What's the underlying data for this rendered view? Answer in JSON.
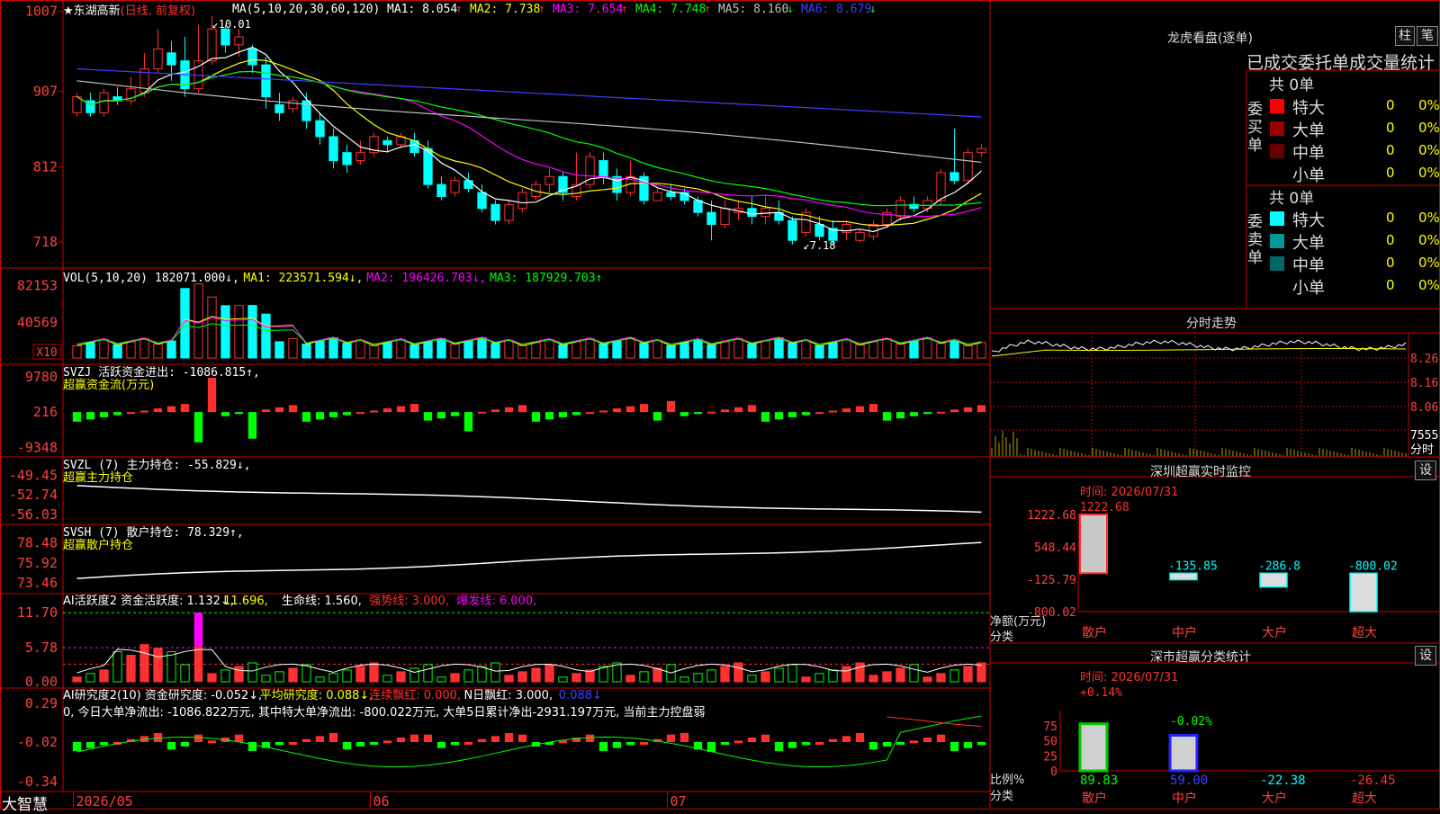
{
  "app": {
    "brand": "大智慧"
  },
  "header": {
    "star": "★",
    "stock_name": "东湖高新",
    "period": "(日线, 前复权)",
    "ma_title": "MA(5,10,20,30,60,120)",
    "ma": [
      {
        "label": "MA1: 8.054",
        "arrow": "↑",
        "color": "#ffffff"
      },
      {
        "label": "MA2: 7.738",
        "arrow": "↑",
        "color": "#ffff00"
      },
      {
        "label": "MA3: 7.654",
        "arrow": "↑",
        "color": "#ff00ff"
      },
      {
        "label": "MA4: 7.748",
        "arrow": "↑",
        "color": "#00ff00"
      },
      {
        "label": "MA5: 8.160",
        "arrow": "↓",
        "color": "#c0c0c0"
      },
      {
        "label": "MA6: 8.679",
        "arrow": "↓",
        "color": "#4040ff"
      }
    ]
  },
  "colors": {
    "up": "#ff3030",
    "down": "#00ffff",
    "grid": "#cc0000",
    "axis_text": "#ff4040",
    "ma1": "#ffffff",
    "ma2": "#ffff00",
    "ma3": "#ff00ff",
    "ma4": "#00ff00",
    "ma5": "#c0c0c0",
    "ma6": "#4040ff",
    "green": "#00ff00"
  },
  "chart_data": [
    {
      "name": "price",
      "type": "candlestick",
      "y_ticks": [
        "1007",
        "907",
        "812",
        "718"
      ],
      "ylim": [
        700,
        1010
      ],
      "annotations": {
        "high": "10.01",
        "low": "7.18"
      },
      "x_labels": [
        "2026/05",
        "06",
        "07"
      ],
      "candles": [
        [
          880,
          900,
          875,
          905
        ],
        [
          895,
          880,
          875,
          905
        ],
        [
          880,
          905,
          875,
          910
        ],
        [
          900,
          895,
          890,
          912
        ],
        [
          895,
          910,
          890,
          925
        ],
        [
          905,
          935,
          900,
          955
        ],
        [
          935,
          960,
          930,
          985
        ],
        [
          955,
          940,
          920,
          970
        ],
        [
          945,
          910,
          900,
          975
        ],
        [
          910,
          945,
          905,
          990
        ],
        [
          945,
          985,
          940,
          1001
        ],
        [
          985,
          965,
          955,
          990
        ],
        [
          965,
          975,
          950,
          985
        ],
        [
          960,
          940,
          930,
          965
        ],
        [
          940,
          900,
          885,
          950
        ],
        [
          890,
          880,
          870,
          905
        ],
        [
          885,
          895,
          880,
          900
        ],
        [
          895,
          870,
          860,
          905
        ],
        [
          870,
          850,
          840,
          880
        ],
        [
          850,
          820,
          810,
          860
        ],
        [
          830,
          815,
          805,
          840
        ],
        [
          820,
          830,
          815,
          845
        ],
        [
          830,
          850,
          825,
          855
        ],
        [
          845,
          840,
          830,
          850
        ],
        [
          840,
          850,
          835,
          855
        ],
        [
          845,
          830,
          825,
          855
        ],
        [
          835,
          790,
          785,
          845
        ],
        [
          790,
          775,
          770,
          800
        ],
        [
          780,
          795,
          775,
          800
        ],
        [
          795,
          785,
          780,
          805
        ],
        [
          780,
          760,
          755,
          790
        ],
        [
          765,
          745,
          740,
          770
        ],
        [
          745,
          765,
          740,
          770
        ],
        [
          760,
          780,
          755,
          785
        ],
        [
          775,
          790,
          770,
          795
        ],
        [
          790,
          800,
          780,
          810
        ],
        [
          800,
          780,
          770,
          805
        ],
        [
          775,
          790,
          770,
          830
        ],
        [
          790,
          825,
          785,
          830
        ],
        [
          820,
          800,
          790,
          830
        ],
        [
          800,
          780,
          770,
          810
        ],
        [
          780,
          800,
          775,
          820
        ],
        [
          800,
          770,
          765,
          805
        ],
        [
          770,
          780,
          770,
          785
        ],
        [
          780,
          775,
          770,
          790
        ],
        [
          780,
          770,
          765,
          785
        ],
        [
          770,
          755,
          750,
          775
        ],
        [
          755,
          740,
          720,
          770
        ],
        [
          740,
          760,
          735,
          770
        ],
        [
          755,
          760,
          745,
          770
        ],
        [
          760,
          750,
          740,
          775
        ],
        [
          750,
          760,
          740,
          775
        ],
        [
          755,
          745,
          740,
          770
        ],
        [
          745,
          720,
          715,
          750
        ],
        [
          730,
          755,
          725,
          760
        ],
        [
          740,
          725,
          720,
          750
        ],
        [
          735,
          720,
          715,
          745
        ],
        [
          730,
          740,
          720,
          745
        ],
        [
          720,
          730,
          718,
          735
        ],
        [
          725,
          740,
          720,
          745
        ],
        [
          740,
          755,
          735,
          760
        ],
        [
          750,
          770,
          745,
          775
        ],
        [
          765,
          760,
          755,
          775
        ],
        [
          760,
          770,
          755,
          775
        ],
        [
          770,
          805,
          765,
          810
        ],
        [
          805,
          795,
          790,
          860
        ],
        [
          795,
          830,
          790,
          835
        ],
        [
          830,
          835,
          825,
          840
        ]
      ]
    },
    {
      "name": "volume",
      "type": "bar",
      "title": "VOL(5,10,20)",
      "values_text": [
        {
          "t": "182071.000↓,",
          "c": "#ffffff"
        },
        {
          "t": "MA1: 223571.594↓,",
          "c": "#ffff00"
        },
        {
          "t": "MA2: 196426.703↓,",
          "c": "#ff00ff"
        },
        {
          "t": "MA3: 187929.703↑",
          "c": "#00ff00"
        }
      ],
      "y_ticks": [
        "82153",
        "40569"
      ],
      "unit": "X10",
      "ylim": [
        0,
        90000
      ]
    },
    {
      "name": "svzj",
      "type": "bar",
      "title": "SVZJ  活跃资金进出: -1086.815↑,",
      "subtitle": "超赢资金流(万元)",
      "y_ticks": [
        "9780",
        "216",
        "-9348"
      ],
      "ylim": [
        -10000,
        10000
      ]
    },
    {
      "name": "svzl",
      "type": "line",
      "title": "SVZL (7) 主力持仓: -55.829↓,",
      "subtitle": "超赢主力持仓",
      "y_ticks": [
        "-49.45",
        "-52.74",
        "-56.03"
      ],
      "ylim": [
        -56.5,
        -48.5
      ]
    },
    {
      "name": "svsh",
      "type": "line",
      "title": "SVSH (7) 散户持仓: 78.329↑,",
      "subtitle": "超赢散户持仓",
      "y_ticks": [
        "78.48",
        "75.92",
        "73.46"
      ],
      "ylim": [
        73.0,
        79.2
      ]
    },
    {
      "name": "ai_active",
      "type": "bar",
      "title_parts": [
        {
          "t": "AI活跃度2 资金活跃度: 1.132↓, ",
          "c": "#ffffff"
        },
        {
          "t": "11.696, ",
          "c": "#ffff00"
        },
        {
          "t": "生命线: 1.560, ",
          "c": "#ffffff"
        },
        {
          "t": "强势线: 3.000, ",
          "c": "#ff3030"
        },
        {
          "t": "爆发线: 6.000, ",
          "c": "#ff00ff"
        }
      ],
      "y_ticks": [
        "11.70",
        "5.78",
        "0.00"
      ],
      "ylim": [
        0,
        12.5
      ]
    },
    {
      "name": "ai_research",
      "type": "bar",
      "title_parts": [
        {
          "t": "AI研究度2(10) 资金研究度: -0.052↓, ",
          "c": "#ffffff"
        },
        {
          "t": "平均研究度: 0.088↓, ",
          "c": "#ffff00"
        },
        {
          "t": "连续飘红: 0.000, ",
          "c": "#ff3030"
        },
        {
          "t": "N日飘红: 3.000, ",
          "c": "#ffffff"
        },
        {
          "t": "0.088↓",
          "c": "#4040ff"
        }
      ],
      "note": "0, 今日大单净流出: -1086.822万元, 其中特大单净流出: -800.022万元, 大单5日累计净出-2931.197万元, 当前主力控盘弱",
      "y_ticks": [
        "0.29",
        "-0.02",
        "-0.34"
      ],
      "ylim": [
        -0.36,
        0.32
      ]
    }
  ],
  "right_panel": {
    "dragon_title": "龙虎看盘(逐单)",
    "btn_bar": "柱",
    "btn_pen": "笔",
    "stats_header": "已成交委托单成交量统计",
    "buy": {
      "side_label": "委买单",
      "total": "共 0单",
      "rows": [
        {
          "name": "特大",
          "color": "#ff0000",
          "n": "0",
          "pct": "0%"
        },
        {
          "name": "大单",
          "color": "#990000",
          "n": "0",
          "pct": "0%"
        },
        {
          "name": "中单",
          "color": "#660000",
          "n": "0",
          "pct": "0%"
        },
        {
          "name": "小单",
          "color": "",
          "n": "0",
          "pct": "0%"
        }
      ]
    },
    "sell": {
      "side_label": "委卖单",
      "total": "共 0单",
      "rows": [
        {
          "name": "特大",
          "color": "#00ffff",
          "n": "0",
          "pct": "0%"
        },
        {
          "name": "大单",
          "color": "#009999",
          "n": "0",
          "pct": "0%"
        },
        {
          "name": "中单",
          "color": "#006666",
          "n": "0",
          "pct": "0%"
        },
        {
          "name": "小单",
          "color": "",
          "n": "0",
          "pct": "0%"
        }
      ]
    },
    "intraday": {
      "title": "分时走势",
      "y_ticks": [
        "8.26",
        "8.16",
        "8.06"
      ],
      "vol_label": "7555",
      "vol_unit": "分时"
    },
    "sz_monitor": {
      "title": "深圳超赢实时监控",
      "set_btn": "设",
      "time": "时间: 2026/07/31",
      "y_ticks": [
        "1222.68",
        "548.44",
        "-125.79",
        "-800.02"
      ],
      "ylim": [
        -800.02,
        1222.68
      ],
      "footer_a": "净额(万元)",
      "footer_b": "分类",
      "categories": [
        "散户",
        "中户",
        "大户",
        "超大"
      ],
      "values": [
        1222.68,
        -135.85,
        -286.8,
        -800.02
      ],
      "labels": [
        "1222.68",
        "-135.85",
        "-286.8",
        "-800.02"
      ]
    },
    "sz_class": {
      "title": "深市超赢分类统计",
      "set_btn": "设",
      "time": "时间: 2026/07/31",
      "y_ticks": [
        "75",
        "50",
        "25",
        "0"
      ],
      "ylim": [
        0,
        100
      ],
      "footer_a": "比例%",
      "footer_b": "分类",
      "categories": [
        "散户",
        "中户",
        "大户",
        "超大"
      ],
      "values": [
        89.83,
        59.0,
        -22.38,
        -26.45
      ],
      "value_labels": [
        "89.83",
        "59.00",
        "-22.38",
        "-26.45"
      ],
      "change_labels": [
        "+0.14%",
        "-0.02%"
      ]
    }
  }
}
